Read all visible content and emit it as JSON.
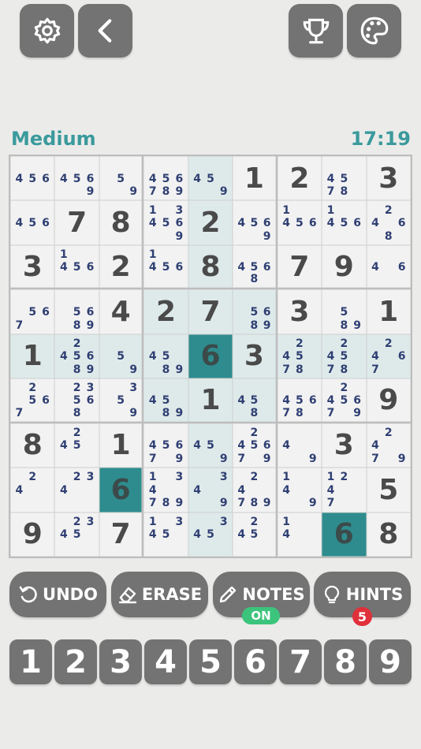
{
  "top": {
    "left_buttons": [
      {
        "name": "settings-button",
        "icon": "gear-icon"
      },
      {
        "name": "back-button",
        "icon": "chevron-left-icon"
      }
    ],
    "right_buttons": [
      {
        "name": "trophy-button",
        "icon": "trophy-icon"
      },
      {
        "name": "theme-button",
        "icon": "palette-icon"
      }
    ]
  },
  "status": {
    "difficulty": "Medium",
    "timer": "17:19"
  },
  "colors": {
    "accent": "#3a9a9c",
    "selected": "#2e8c8e",
    "highlight": "#deeaea",
    "note": "#2f3f73",
    "button": "#737373"
  },
  "board": {
    "selected_cell": [
      4,
      4
    ],
    "cells": [
      [
        {
          "n": [
            4,
            5,
            6
          ]
        },
        {
          "n": [
            4,
            5,
            6,
            9
          ]
        },
        {
          "n": [
            5,
            9
          ]
        },
        {
          "n": [
            4,
            5,
            6,
            7,
            8,
            9
          ]
        },
        {
          "n": [
            4,
            5,
            9
          ]
        },
        {
          "v": "1"
        },
        {
          "v": "2"
        },
        {
          "n": [
            4,
            5,
            7,
            8
          ]
        },
        {
          "v": "3"
        }
      ],
      [
        {
          "n": [
            4,
            5,
            6
          ]
        },
        {
          "v": "7"
        },
        {
          "v": "8"
        },
        {
          "n": [
            1,
            3,
            4,
            5,
            6,
            9
          ]
        },
        {
          "v": "2"
        },
        {
          "n": [
            4,
            5,
            6,
            9
          ]
        },
        {
          "n": [
            1,
            4,
            5,
            6
          ]
        },
        {
          "n": [
            1,
            4,
            5,
            6
          ]
        },
        {
          "n": [
            2,
            4,
            6,
            8
          ]
        }
      ],
      [
        {
          "v": "3"
        },
        {
          "n": [
            1,
            4,
            5,
            6
          ]
        },
        {
          "v": "2"
        },
        {
          "n": [
            1,
            4,
            5,
            6
          ]
        },
        {
          "v": "8"
        },
        {
          "n": [
            4,
            5,
            6,
            8
          ]
        },
        {
          "v": "7"
        },
        {
          "v": "9"
        },
        {
          "n": [
            4,
            6
          ]
        }
      ],
      [
        {
          "n": [
            5,
            6,
            7
          ]
        },
        {
          "n": [
            5,
            6,
            8,
            9
          ]
        },
        {
          "v": "4"
        },
        {
          "v": "2"
        },
        {
          "v": "7"
        },
        {
          "n": [
            5,
            6,
            8,
            9
          ]
        },
        {
          "v": "3"
        },
        {
          "n": [
            5,
            8,
            9
          ]
        },
        {
          "v": "1"
        }
      ],
      [
        {
          "v": "1"
        },
        {
          "n": [
            2,
            4,
            5,
            6,
            8,
            9
          ]
        },
        {
          "n": [
            5,
            9
          ]
        },
        {
          "n": [
            4,
            5,
            8,
            9
          ]
        },
        {
          "v": "6"
        },
        {
          "v": "3"
        },
        {
          "n": [
            2,
            4,
            5,
            7,
            8
          ]
        },
        {
          "n": [
            2,
            4,
            5,
            7,
            8
          ]
        },
        {
          "n": [
            2,
            4,
            6,
            7
          ]
        }
      ],
      [
        {
          "n": [
            2,
            5,
            6,
            7
          ]
        },
        {
          "n": [
            2,
            3,
            5,
            6,
            8
          ]
        },
        {
          "n": [
            3,
            5,
            9
          ]
        },
        {
          "n": [
            4,
            5,
            8,
            9
          ]
        },
        {
          "v": "1"
        },
        {
          "n": [
            4,
            5,
            8
          ]
        },
        {
          "n": [
            4,
            5,
            6,
            7,
            8
          ]
        },
        {
          "n": [
            2,
            4,
            5,
            6,
            7,
            9
          ]
        },
        {
          "v": "9"
        }
      ],
      [
        {
          "v": "8"
        },
        {
          "n": [
            2,
            4,
            5
          ]
        },
        {
          "v": "1"
        },
        {
          "n": [
            4,
            5,
            6,
            7,
            9
          ]
        },
        {
          "n": [
            4,
            5,
            9
          ]
        },
        {
          "n": [
            2,
            4,
            5,
            6,
            7,
            9
          ]
        },
        {
          "n": [
            4,
            9
          ]
        },
        {
          "v": "3"
        },
        {
          "n": [
            2,
            4,
            7,
            9
          ]
        }
      ],
      [
        {
          "n": [
            2,
            4
          ]
        },
        {
          "n": [
            2,
            3,
            4
          ]
        },
        {
          "v": "6"
        },
        {
          "n": [
            1,
            3,
            4,
            7,
            8,
            9
          ]
        },
        {
          "n": [
            3,
            4,
            9
          ]
        },
        {
          "n": [
            2,
            4,
            7,
            8,
            9
          ]
        },
        {
          "n": [
            1,
            4,
            9
          ]
        },
        {
          "n": [
            1,
            2,
            4,
            7
          ]
        },
        {
          "v": "5"
        }
      ],
      [
        {
          "v": "9"
        },
        {
          "n": [
            2,
            3,
            4,
            5
          ]
        },
        {
          "v": "7"
        },
        {
          "n": [
            1,
            3,
            4,
            5
          ]
        },
        {
          "n": [
            3,
            4,
            5
          ]
        },
        {
          "n": [
            2,
            4,
            5
          ]
        },
        {
          "n": [
            1,
            4
          ]
        },
        {
          "v": "6"
        },
        {
          "v": "8"
        }
      ]
    ]
  },
  "actions": {
    "undo": {
      "label": "UNDO",
      "icon": "undo-icon"
    },
    "erase": {
      "label": "ERASE",
      "icon": "eraser-icon"
    },
    "notes": {
      "label": "NOTES",
      "icon": "pencil-icon",
      "badge": "ON"
    },
    "hints": {
      "label": "HINTS",
      "icon": "lightbulb-icon",
      "badge": "5"
    }
  },
  "numpad": [
    "1",
    "2",
    "3",
    "4",
    "5",
    "6",
    "7",
    "8",
    "9"
  ]
}
